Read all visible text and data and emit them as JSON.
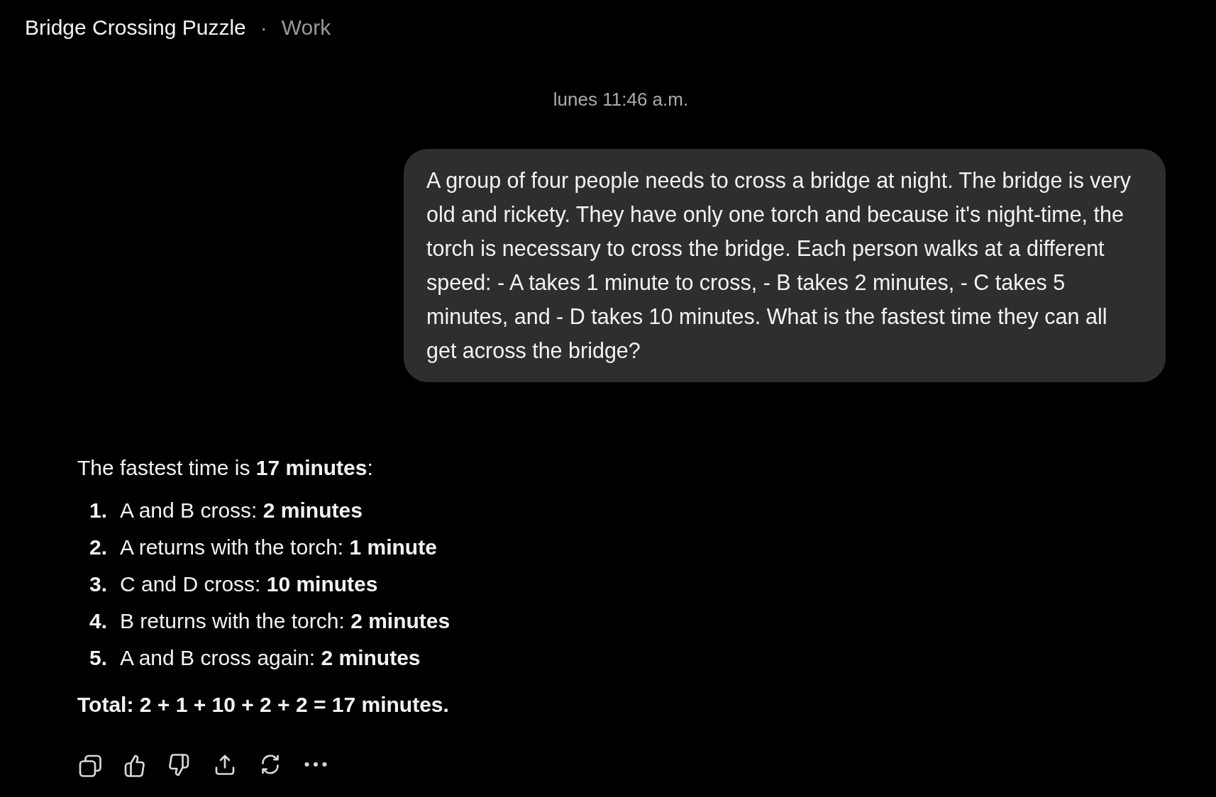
{
  "header": {
    "title": "Bridge Crossing Puzzle",
    "separator": "·",
    "project": "Work"
  },
  "timestamp": "lunes 11:46 a.m.",
  "user_message": "A group of four people needs to cross a bridge at night. The bridge is very old and rickety. They have only one torch and because it's night-time, the torch is necessary to cross the bridge. Each person walks at a different speed: - A takes 1 minute to cross, - B takes 2 minutes, - C takes 5 minutes, and - D takes 10 minutes. What is the fastest time they can all get across the bridge?",
  "response": {
    "intro": "The fastest time is **17 minutes**:",
    "steps": [
      {
        "number": "1.",
        "text": "A and B cross: **2 minutes**"
      },
      {
        "number": "2.",
        "text": "A returns with the torch: **1 minute**"
      },
      {
        "number": "3.",
        "text": "C and D cross: **10 minutes**"
      },
      {
        "number": "4.",
        "text": "B returns with the torch: **2 minutes**"
      },
      {
        "number": "5.",
        "text": "A and B cross again: **2 minutes**"
      }
    ],
    "total": "Total: 2 + 1 + 10 + 2 + 2 = 17 minutes."
  }
}
